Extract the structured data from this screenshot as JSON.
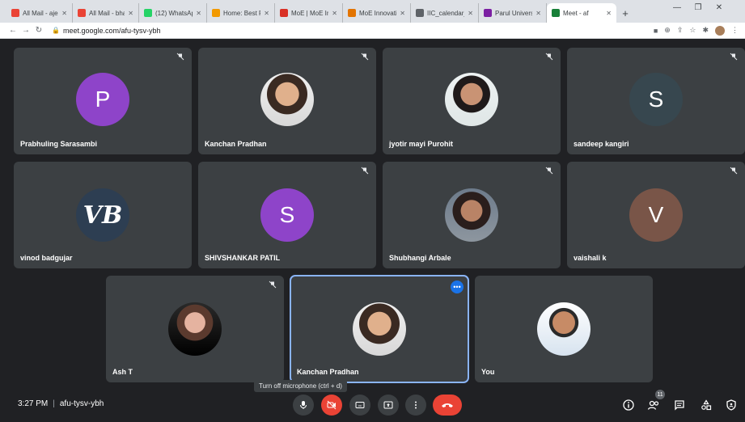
{
  "browser": {
    "tabs": [
      {
        "label": "All Mail - ajee",
        "color": "#ea4335"
      },
      {
        "label": "All Mail - bha",
        "color": "#ea4335"
      },
      {
        "label": "(12) WhatsAp",
        "color": "#25d366"
      },
      {
        "label": "Home: Best Fr",
        "color": "#f29900"
      },
      {
        "label": "MoE | MoE In",
        "color": "#d93025"
      },
      {
        "label": "MoE Innovatio",
        "color": "#e37400"
      },
      {
        "label": "IIC_calendar_",
        "color": "#5f6368"
      },
      {
        "label": "Parul Univers",
        "color": "#7b1fa2"
      },
      {
        "label": "Meet - af",
        "color": "#188038"
      }
    ],
    "url": "meet.google.com/afu-tysv-ybh"
  },
  "participants": [
    {
      "name": "Prabhuling Sarasambi",
      "initial": "P",
      "color": "#8e44c9"
    },
    {
      "name": "Kanchan Pradhan"
    },
    {
      "name": "jyotir mayi Purohit"
    },
    {
      "name": "sandeep kangiri",
      "initial": "S",
      "color": "#37474f"
    },
    {
      "name": "vinod badgujar",
      "initial": "VB",
      "color": "#2d3e52"
    },
    {
      "name": "SHIVSHANKAR PATIL",
      "initial": "S",
      "color": "#8e44c9"
    },
    {
      "name": "Shubhangi Arbale"
    },
    {
      "name": "vaishali k",
      "initial": "V",
      "color": "#795548"
    },
    {
      "name": "Ash T"
    },
    {
      "name": "Kanchan Pradhan"
    },
    {
      "name": "You"
    }
  ],
  "meeting": {
    "time": "3:27 PM",
    "code": "afu-tysv-ybh",
    "tooltip": "Turn off microphone (ctrl + d)",
    "participant_count": "11"
  },
  "colors": {
    "background": "#202124",
    "tile": "#3c4043",
    "end_call": "#ea4335",
    "active_outline": "#8ab4f8"
  }
}
